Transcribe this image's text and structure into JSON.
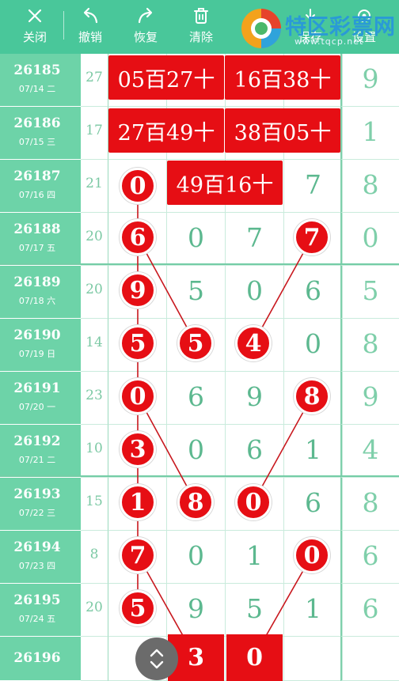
{
  "toolbar": {
    "close_label": "关闭",
    "undo_label": "撤销",
    "redo_label": "恢复",
    "clear_label": "清除",
    "save_label": "保存",
    "settings_label": "设置"
  },
  "watermark": {
    "brand": "特区彩票网",
    "url": "www.tqcp.net"
  },
  "rows": [
    {
      "issue": "26185",
      "date": "07/14 二",
      "sum": "27",
      "digits": [
        "",
        "",
        "",
        ""
      ],
      "last": "9"
    },
    {
      "issue": "26186",
      "date": "07/15 三",
      "sum": "17",
      "digits": [
        "",
        "",
        "",
        ""
      ],
      "last": "1"
    },
    {
      "issue": "26187",
      "date": "07/16 四",
      "sum": "21",
      "digits": [
        "",
        "",
        "",
        "7"
      ],
      "last": "8"
    },
    {
      "issue": "26188",
      "date": "07/17 五",
      "sum": "20",
      "digits": [
        "",
        "0",
        "7",
        ""
      ],
      "last": "0"
    },
    {
      "issue": "26189",
      "date": "07/18 六",
      "sum": "20",
      "digits": [
        "",
        "5",
        "0",
        "6"
      ],
      "last": "5"
    },
    {
      "issue": "26190",
      "date": "07/19 日",
      "sum": "14",
      "digits": [
        "",
        "",
        "",
        "0"
      ],
      "last": "8"
    },
    {
      "issue": "26191",
      "date": "07/20 一",
      "sum": "23",
      "digits": [
        "",
        "6",
        "9",
        ""
      ],
      "last": "9"
    },
    {
      "issue": "26192",
      "date": "07/21 二",
      "sum": "10",
      "digits": [
        "",
        "0",
        "6",
        "1"
      ],
      "last": "4"
    },
    {
      "issue": "26193",
      "date": "07/22 三",
      "sum": "15",
      "digits": [
        "",
        "",
        "",
        "6"
      ],
      "last": "8"
    },
    {
      "issue": "26194",
      "date": "07/23 四",
      "sum": "8",
      "digits": [
        "",
        "0",
        "1",
        ""
      ],
      "last": "6"
    },
    {
      "issue": "26195",
      "date": "07/24 五",
      "sum": "20",
      "digits": [
        "",
        "9",
        "5",
        "1"
      ],
      "last": "6"
    },
    {
      "issue": "26196",
      "date": "",
      "sum": "",
      "digits": [
        "",
        "",
        "",
        ""
      ],
      "last": ""
    }
  ],
  "pairs": [
    {
      "text": "05百27十"
    },
    {
      "text": "16百38十"
    },
    {
      "text": "27百49十"
    },
    {
      "text": "38百05十"
    },
    {
      "text": "49百16十"
    }
  ],
  "balls": [
    {
      "value": "0"
    },
    {
      "value": "6"
    },
    {
      "value": "7"
    },
    {
      "value": "9"
    },
    {
      "value": "5"
    },
    {
      "value": "5"
    },
    {
      "value": "4"
    },
    {
      "value": "0"
    },
    {
      "value": "8"
    },
    {
      "value": "3"
    },
    {
      "value": "1"
    },
    {
      "value": "8"
    },
    {
      "value": "0"
    },
    {
      "value": "7"
    },
    {
      "value": "0"
    },
    {
      "value": "5"
    }
  ],
  "pending": [
    "3",
    "0"
  ],
  "colors": {
    "accent": "#49c79a",
    "ball": "#e60e14",
    "digit": "#5cb88f"
  }
}
